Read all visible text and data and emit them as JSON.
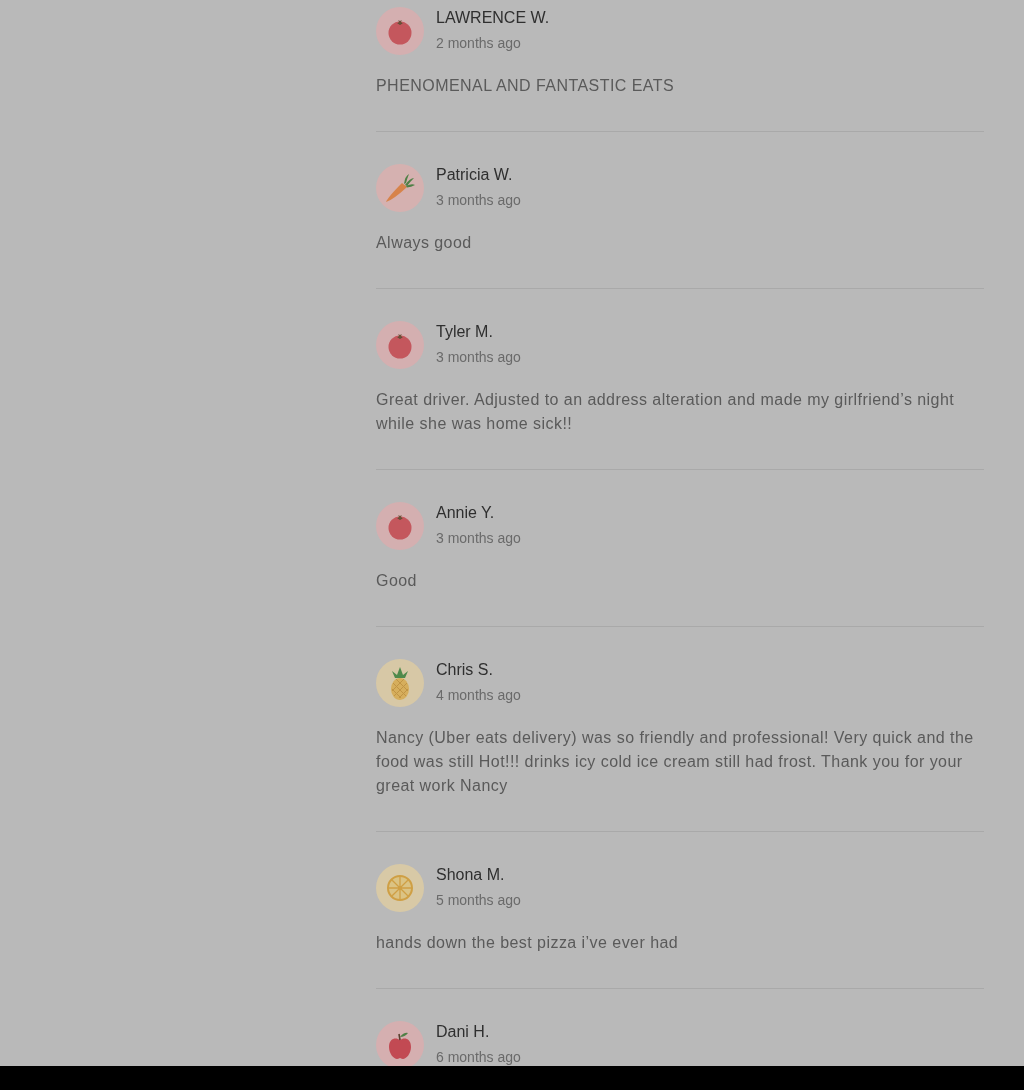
{
  "reviews": [
    {
      "avatar": {
        "kind": "tomato"
      },
      "name": "LAWRENCE W.",
      "time": "2 months ago",
      "text": "PHENOMENAL AND FANTASTIC EATS"
    },
    {
      "avatar": {
        "kind": "carrot"
      },
      "name": "Patricia W.",
      "time": "3 months ago",
      "text": "Always good"
    },
    {
      "avatar": {
        "kind": "tomato"
      },
      "name": "Tyler M.",
      "time": "3 months ago",
      "text": "Great driver. Adjusted to an address alteration and made my girlfriend’s night while she was home sick!!"
    },
    {
      "avatar": {
        "kind": "tomato"
      },
      "name": "Annie Y.",
      "time": "3 months ago",
      "text": "Good"
    },
    {
      "avatar": {
        "kind": "pineapple"
      },
      "name": "Chris S.",
      "time": "4 months ago",
      "text": "Nancy (Uber eats delivery) was so friendly and professional! Very quick and the food was still Hot!!! drinks icy cold ice cream still had frost. Thank you for your great work Nancy"
    },
    {
      "avatar": {
        "kind": "citrus"
      },
      "name": "Shona M.",
      "time": "5 months ago",
      "text": "hands down the best pizza i’ve ever had"
    },
    {
      "avatar": {
        "kind": "apple"
      },
      "name": "Dani H.",
      "time": "6 months ago"
    }
  ]
}
